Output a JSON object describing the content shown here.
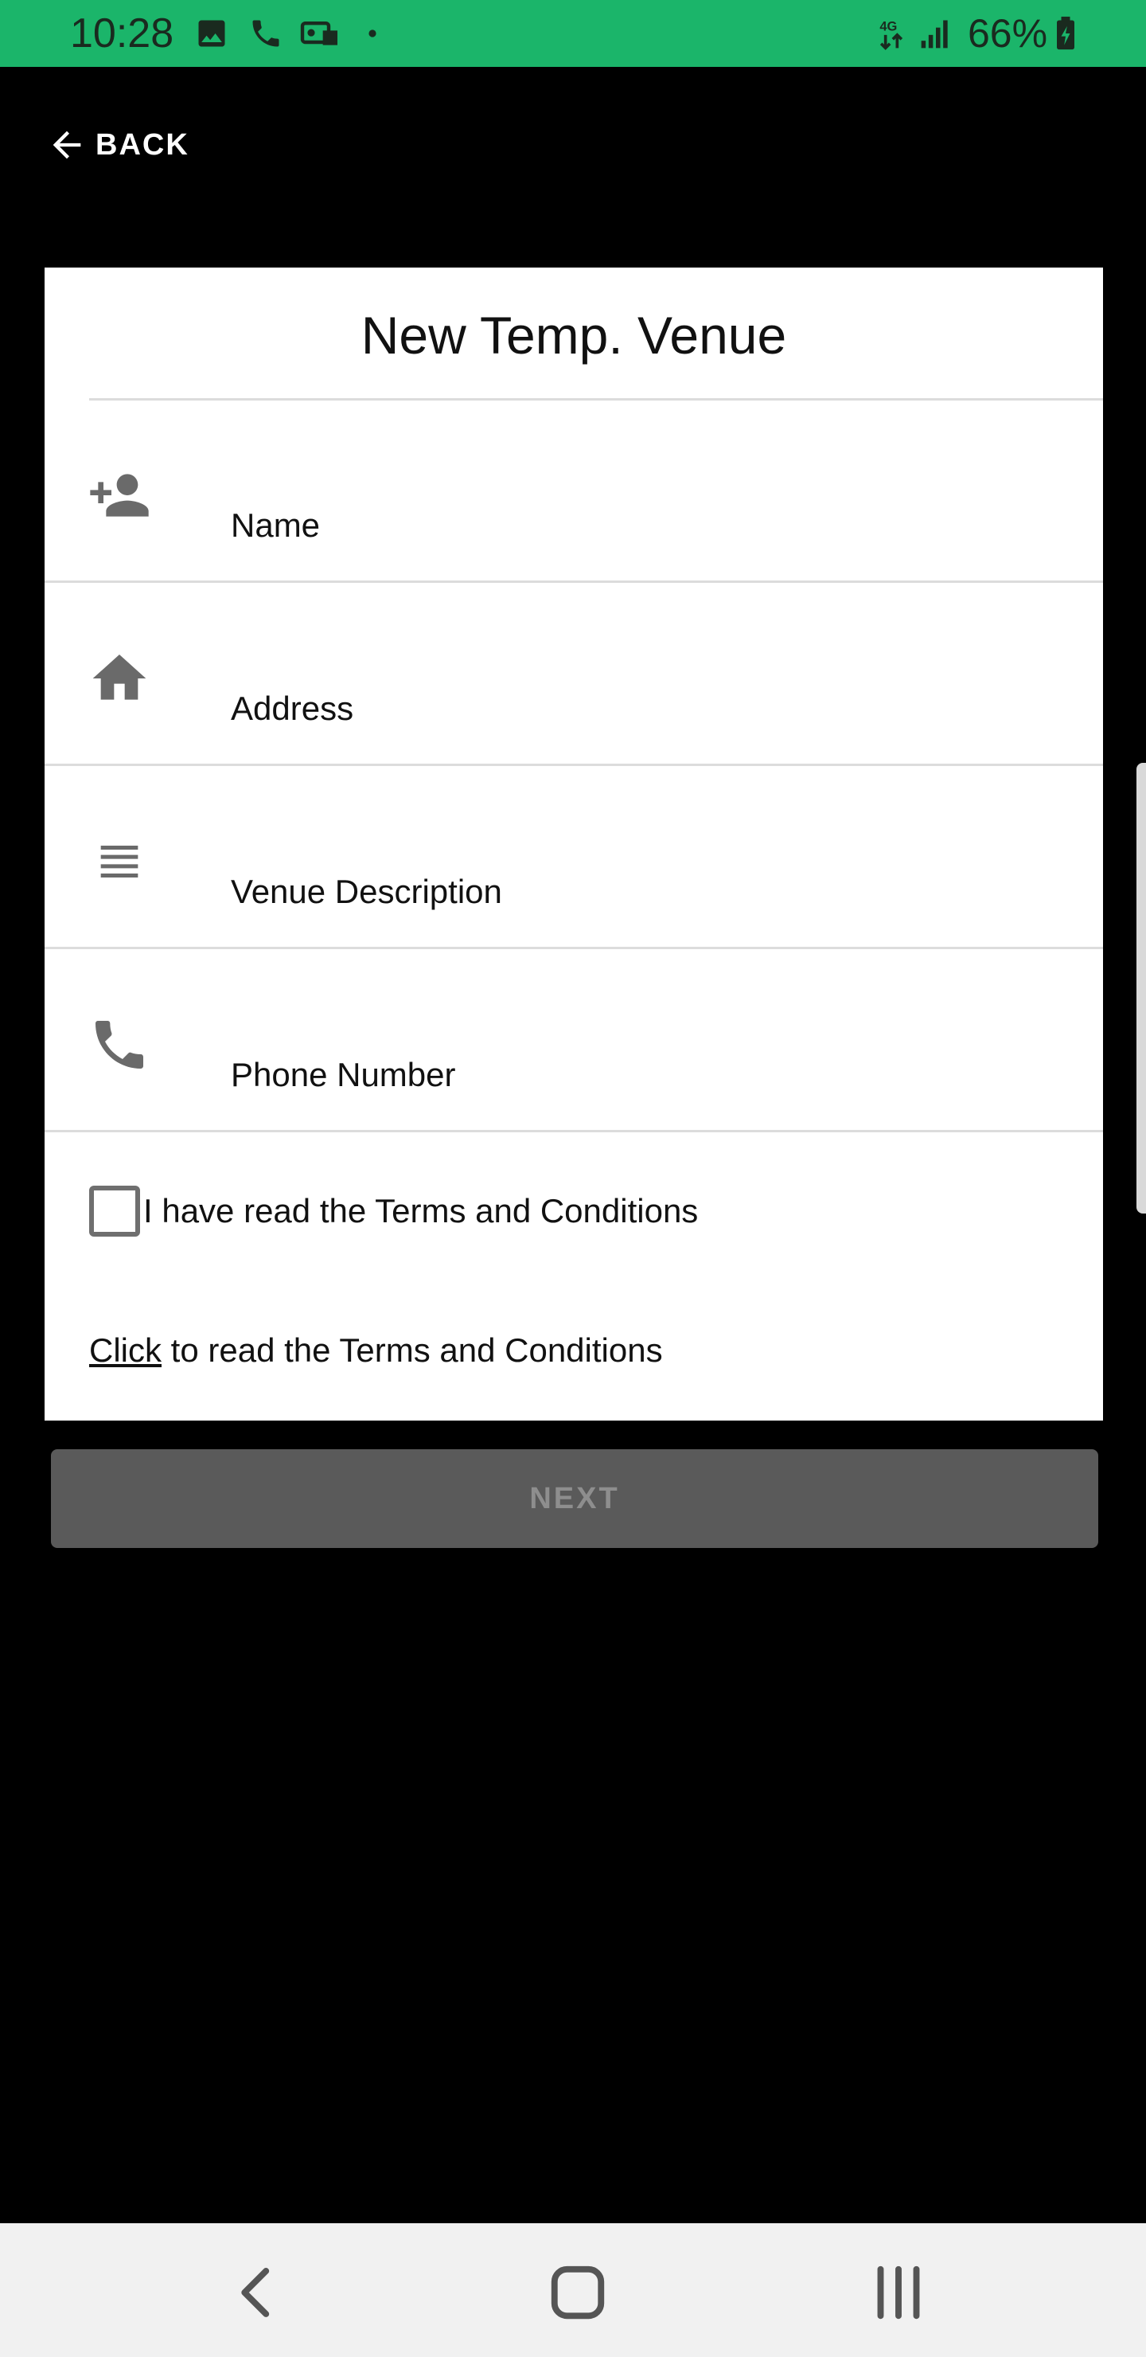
{
  "status_bar": {
    "time": "10:28",
    "battery": "66%",
    "icons": [
      "gallery-icon",
      "phone-icon",
      "voicemail-icon",
      "dot-icon",
      "data-4g-icon",
      "signal-icon",
      "battery-charging-icon"
    ]
  },
  "app_bar": {
    "back_label": "BACK"
  },
  "form": {
    "title": "New Temp. Venue",
    "fields": [
      {
        "label": "Name",
        "icon": "add-person-icon"
      },
      {
        "label": "Address",
        "icon": "home-icon"
      },
      {
        "label": "Venue Description",
        "icon": "notes-icon"
      },
      {
        "label": "Phone Number",
        "icon": "phone-icon"
      }
    ],
    "terms_checkbox_label": "I have read the Terms and Conditions",
    "terms_checked": false,
    "click_link": "Click",
    "click_suffix": " to read the Terms and Conditions"
  },
  "next_button": {
    "label": "NEXT",
    "enabled": false
  },
  "colors": {
    "status_bar": "#1bb56a",
    "background": "#000000",
    "card": "#ffffff",
    "button_disabled": "#5a5a5a"
  },
  "nav_bar": {
    "buttons": [
      "back-nav-icon",
      "home-nav-icon",
      "recents-nav-icon"
    ]
  }
}
